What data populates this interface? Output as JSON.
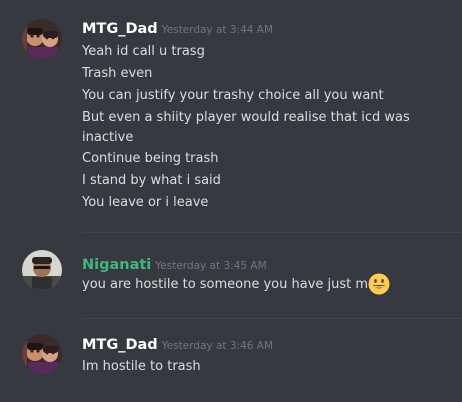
{
  "messages": [
    {
      "author": "MTG_Dad",
      "author_color": "#ffffff",
      "timestamp": "Yesterday at 3:44 AM",
      "lines": [
        "Yeah id call u trasg",
        "Trash even",
        "You can justify your trashy choice all you want",
        "But even a shiity player would realise that icd was",
        "inactive",
        "Continue being trash",
        "I stand by what i said",
        "You leave or i leave"
      ]
    },
    {
      "author": "Niganati",
      "author_color": "#43b581",
      "timestamp": "Yesterday at 3:45 AM",
      "lines": [
        "you are hostile to someone you have just met"
      ],
      "emoji": "smiley-face-emoji"
    },
    {
      "author": "MTG_Dad",
      "author_color": "#ffffff",
      "timestamp": "Yesterday at 3:46 AM",
      "lines": [
        "Im hostile to trash"
      ]
    }
  ]
}
